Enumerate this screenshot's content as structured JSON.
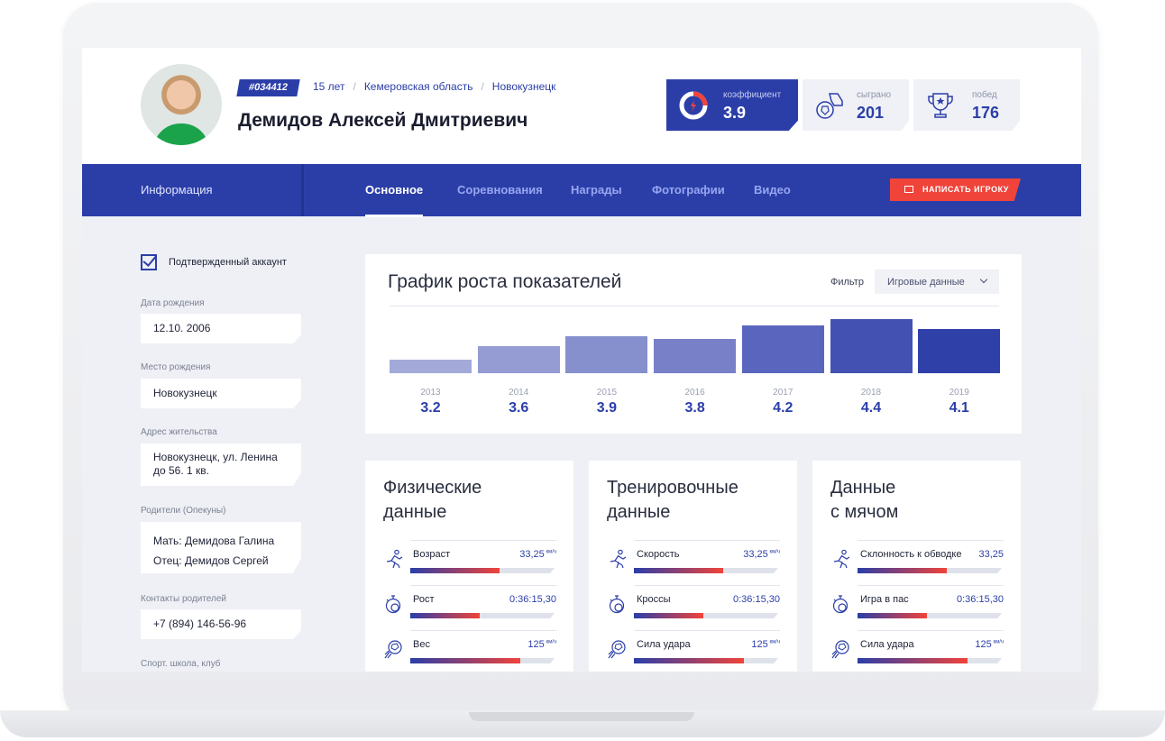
{
  "profile": {
    "id_tag": "#034412",
    "age": "15 лет",
    "region": "Кемеровская область",
    "city": "Новокузнецк",
    "name": "Демидов Алексей Дмитриевич"
  },
  "stats": [
    {
      "label": "коэффициент",
      "value": "3.9",
      "icon": "gauge-icon"
    },
    {
      "label": "сыграно",
      "value": "201",
      "icon": "ball-boot-icon"
    },
    {
      "label": "побед",
      "value": "176",
      "icon": "trophy-icon"
    }
  ],
  "nav": {
    "info": "Информация",
    "tabs": [
      "Основное",
      "Соревнования",
      "Награды",
      "Фотографии",
      "Видео"
    ],
    "message_button": "НАПИСАТЬ ИГРОКУ"
  },
  "sidebar": {
    "verified": "Подтвержденный аккаунт",
    "birth_date_label": "Дата рождения",
    "birth_date": "12.10. 2006",
    "birth_place_label": "Место рождения",
    "birth_place": "Новокузнецк",
    "address_label": "Адрес жительства",
    "address_line1": "Новокузнецк, ул. Ленина",
    "address_line2": "до 56. 1 кв.",
    "parents_label": "Родители (Опекуны)",
    "mother_prefix": "Мать:",
    "mother": "Демидова Галина",
    "father_prefix": "Отец:",
    "father": "Демидов Сергей",
    "contacts_label": "Контакты родителей",
    "contacts": "+7 (894) 146-56-96",
    "school_label": "Спорт. школа, клуб"
  },
  "growth": {
    "title": "График роста показателей",
    "filter_label": "Фильтр",
    "filter_value": "Игровые данные"
  },
  "chart_data": {
    "type": "bar",
    "categories": [
      "2013",
      "2014",
      "2015",
      "2016",
      "2017",
      "2018",
      "2019"
    ],
    "values": [
      3.2,
      3.6,
      3.9,
      3.8,
      4.2,
      4.4,
      4.1
    ],
    "value_labels": [
      "3.2",
      "3.6",
      "3.9",
      "3.8",
      "4.2",
      "4.4",
      "4.1"
    ],
    "colors": [
      "#a3aad9",
      "#949cd3",
      "#8690cd",
      "#7880c7",
      "#5a66bd",
      "#4352b2",
      "#2f40a8"
    ],
    "title": "График роста показателей",
    "xlabel": "",
    "ylabel": "",
    "ylim": [
      2.8,
      4.5
    ],
    "grid": false
  },
  "panels": [
    {
      "title_line1": "Физические",
      "title_line2": "данные",
      "rows": [
        {
          "label": "Возраст",
          "value": "33,25",
          "unit": "км/ч",
          "fill": 0.62,
          "icon": "runner-icon"
        },
        {
          "label": "Рост",
          "value": "0:36:15,30",
          "unit": "",
          "fill": 0.48,
          "icon": "stopwatch-icon"
        },
        {
          "label": "Вес",
          "value": "125",
          "unit": "км/ч",
          "fill": 0.76,
          "icon": "ball-kick-icon"
        }
      ]
    },
    {
      "title_line1": "Тренировочные",
      "title_line2": "данные",
      "rows": [
        {
          "label": "Скорость",
          "value": "33,25",
          "unit": "км/ч",
          "fill": 0.62,
          "icon": "runner-icon"
        },
        {
          "label": "Кроссы",
          "value": "0:36:15,30",
          "unit": "",
          "fill": 0.48,
          "icon": "stopwatch-icon"
        },
        {
          "label": "Сила удара",
          "value": "125",
          "unit": "км/ч",
          "fill": 0.76,
          "icon": "ball-kick-icon"
        }
      ]
    },
    {
      "title_line1": "Данные",
      "title_line2": "с мячом",
      "rows": [
        {
          "label": "Склонность к обводке",
          "value": "33,25",
          "unit": "",
          "fill": 0.62,
          "icon": "runner-icon"
        },
        {
          "label": "Игра в  пас",
          "value": "0:36:15,30",
          "unit": "",
          "fill": 0.48,
          "icon": "stopwatch-icon"
        },
        {
          "label": "Сила удара",
          "value": "125",
          "unit": "км/ч",
          "fill": 0.76,
          "icon": "ball-kick-icon"
        }
      ]
    }
  ]
}
